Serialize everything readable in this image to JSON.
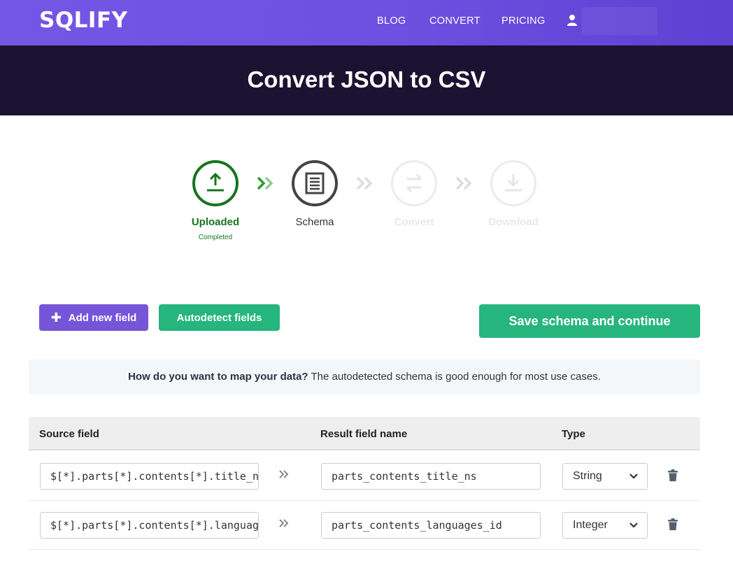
{
  "nav": {
    "logo": "SQLIFY",
    "links": [
      "BLOG",
      "CONVERT",
      "PRICING"
    ],
    "user_icon": "user-icon"
  },
  "hero": {
    "title": "Convert JSON to CSV"
  },
  "steps": [
    {
      "label": "Uploaded",
      "sub": "Completed",
      "state": "done",
      "icon": "upload-icon"
    },
    {
      "label": "Schema",
      "sub": "",
      "state": "active",
      "icon": "document-icon"
    },
    {
      "label": "Convert",
      "sub": "",
      "state": "todo",
      "icon": "swap-icon"
    },
    {
      "label": "Download",
      "sub": "",
      "state": "todo",
      "icon": "download-icon"
    }
  ],
  "actions": {
    "add_field": "Add new field",
    "autodetect": "Autodetect fields",
    "save": "Save schema and continue"
  },
  "info": {
    "question": "How do you want to map your data?",
    "text": " The autodetected schema is good enough for most use cases."
  },
  "table": {
    "headers": {
      "source": "Source field",
      "result": "Result field name",
      "type": "Type"
    },
    "rows": [
      {
        "source": "$[*].parts[*].contents[*].title_ns",
        "result": "parts_contents_title_ns",
        "type": "String"
      },
      {
        "source": "$[*].parts[*].contents[*].languages_id",
        "result": "parts_contents_languages_id",
        "type": "Integer"
      }
    ]
  },
  "colors": {
    "nav": "#7656e4",
    "hero": "#1b1130",
    "done": "#17741e",
    "add_button": "#7655d9",
    "green_button": "#27b57e"
  }
}
